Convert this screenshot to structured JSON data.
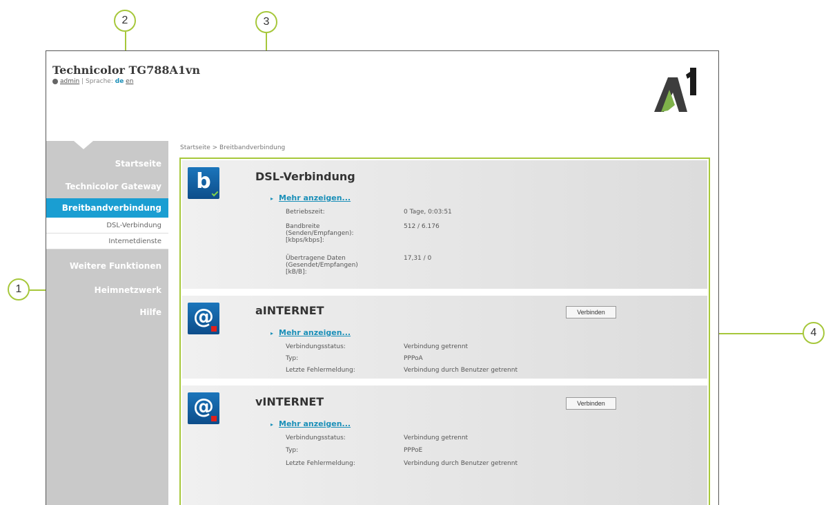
{
  "header": {
    "device_title": "Technicolor TG788A1vn",
    "user": "admin",
    "separator": "|",
    "language_label": "Sprache:",
    "lang_active": "de",
    "lang_other": "en"
  },
  "logo": {
    "text": "A1"
  },
  "sidebar": {
    "items": [
      {
        "label": "Startseite"
      },
      {
        "label": "Technicolor Gateway"
      },
      {
        "label": "Breitbandverbindung"
      },
      {
        "label": "Weitere Funktionen"
      },
      {
        "label": "Heimnetzwerk"
      },
      {
        "label": "Hilfe"
      }
    ],
    "subitems": [
      {
        "label": "DSL-Verbindung"
      },
      {
        "label": "Internetdienste"
      }
    ]
  },
  "breadcrumb": "Startseite > Breitbandverbindung",
  "cards": [
    {
      "title": "DSL-Verbindung",
      "icon_text": "b",
      "more": "Mehr anzeigen...",
      "rows": [
        {
          "label": "Betriebszeit:",
          "value": "0 Tage, 0:03:51"
        },
        {
          "label": "Bandbreite (Senden/Empfangen): [kbps/kbps]:",
          "value": "512 / 6.176"
        },
        {
          "label": "Übertragene Daten (Gesendet/Empfangen) [kB/B]:",
          "value": "17,31 / 0"
        }
      ]
    },
    {
      "title": "aINTERNET",
      "icon_text": "@",
      "more": "Mehr anzeigen...",
      "button": "Verbinden",
      "rows": [
        {
          "label": "Verbindungsstatus:",
          "value": "Verbindung getrennt"
        },
        {
          "label": "Typ:",
          "value": "PPPoA"
        },
        {
          "label": "Letzte Fehlermeldung:",
          "value": "Verbindung durch Benutzer getrennt"
        }
      ]
    },
    {
      "title": "vINTERNET",
      "icon_text": "@",
      "more": "Mehr anzeigen...",
      "button": "Verbinden",
      "rows": [
        {
          "label": "Verbindungsstatus:",
          "value": "Verbindung getrennt"
        },
        {
          "label": "Typ:",
          "value": "PPPoE"
        },
        {
          "label": "Letzte Fehlermeldung:",
          "value": "Verbindung durch Benutzer getrennt"
        }
      ]
    }
  ],
  "callouts": [
    "1",
    "2",
    "3",
    "4"
  ],
  "colors": {
    "accent": "#a6c73a",
    "active_nav": "#1a9ed2",
    "link": "#1a8fb8",
    "icon_bg": "#1b75bb"
  }
}
